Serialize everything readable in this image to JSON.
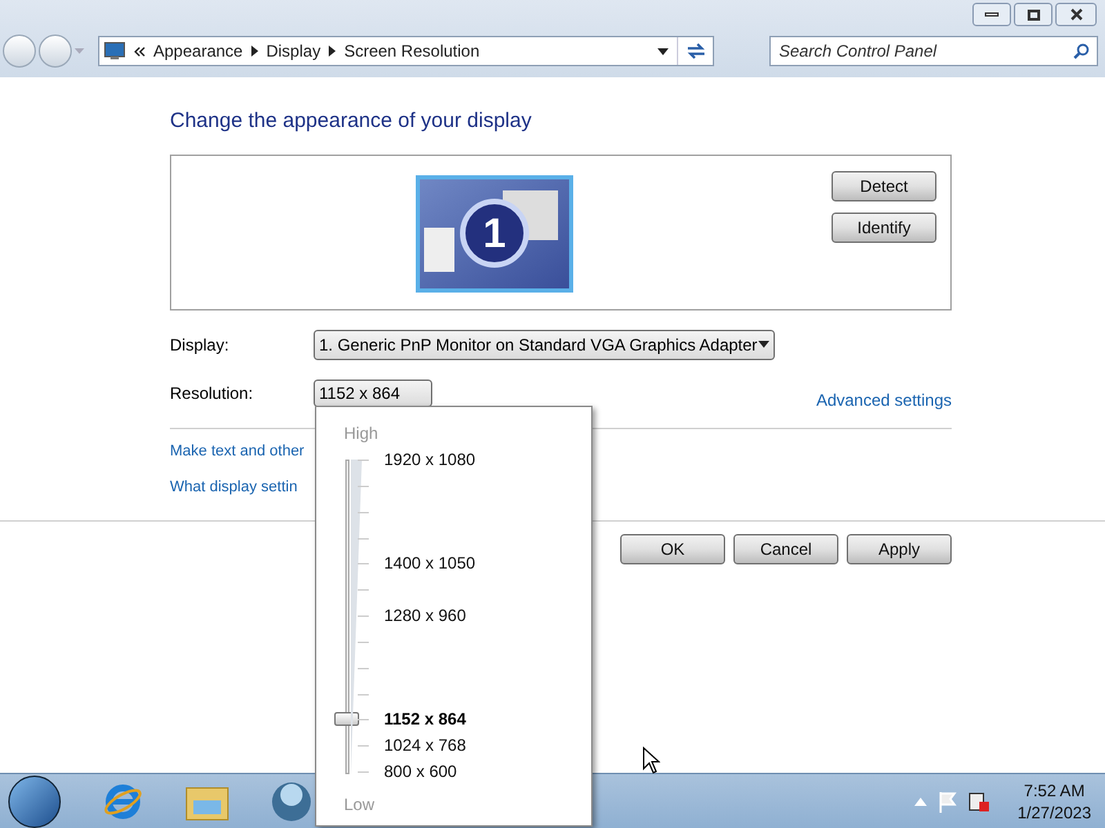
{
  "address_bar": {
    "breadcrumbs": [
      "Appearance",
      "Display",
      "Screen Resolution"
    ]
  },
  "search": {
    "placeholder": "Search Control Panel"
  },
  "heading": "Change the appearance of your display",
  "monitor_preview": {
    "number": "1"
  },
  "preview_buttons": [
    "Detect",
    "Identify"
  ],
  "display": {
    "label": "Display:",
    "value": "1. Generic PnP Monitor on Standard VGA Graphics Adapter"
  },
  "resolution": {
    "label": "Resolution:",
    "value": "1152 x 864"
  },
  "advanced_link": "Advanced settings",
  "links": [
    "Make text and other",
    "What display settin"
  ],
  "dialog_buttons": [
    "OK",
    "Cancel",
    "Apply"
  ],
  "resolution_popup": {
    "high": "High",
    "low": "Low",
    "level": 0.167,
    "steps": [
      {
        "kind": "labeled",
        "label": "1920 x 1080",
        "selected": false
      },
      {
        "kind": "tick"
      },
      {
        "kind": "tick"
      },
      {
        "kind": "tick"
      },
      {
        "kind": "labeled",
        "label": "1400 x 1050",
        "selected": false
      },
      {
        "kind": "tick"
      },
      {
        "kind": "labeled",
        "label": "1280 x 960",
        "selected": false
      },
      {
        "kind": "tick"
      },
      {
        "kind": "tick"
      },
      {
        "kind": "tick"
      },
      {
        "kind": "labeled",
        "label": "1152 x 864",
        "selected": true
      },
      {
        "kind": "labeled",
        "label": "1024 x 768",
        "selected": false
      },
      {
        "kind": "labeled",
        "label": "800 x 600",
        "selected": false
      }
    ]
  },
  "taskbar": {
    "time": "7:52 AM",
    "date": "1/27/2023"
  }
}
